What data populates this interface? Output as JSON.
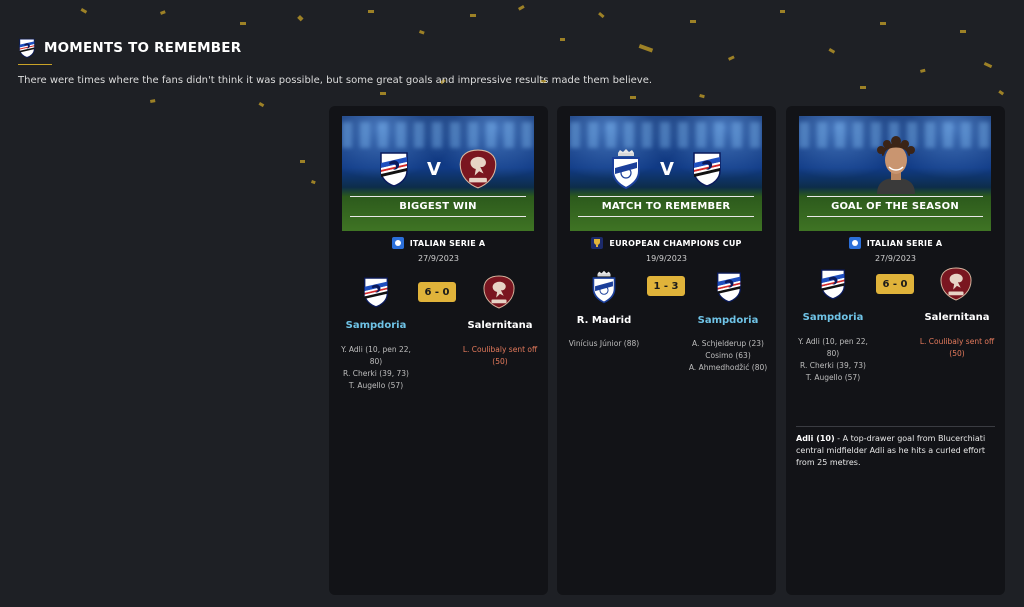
{
  "header": {
    "title": "MOMENTS TO REMEMBER",
    "subtitle": "There were times where the fans didn't think it was possible, but some great goals and impressive results made them believe.",
    "club_icon": "sampdoria-crest-icon"
  },
  "colors": {
    "accent_gold": "#e0b33a",
    "team_blue": "#6fc3e6",
    "red_card_text": "#e47a5c",
    "card_bg": "#121317"
  },
  "cards": [
    {
      "banner_label": "BIGGEST WIN",
      "banner_separator": "V",
      "banner_crests": [
        "sampdoria-crest-icon",
        "salernitana-crest-icon"
      ],
      "competition": "ITALIAN SERIE A",
      "competition_icon": "serie-a-icon",
      "date": "27/9/2023",
      "score": "6 - 0",
      "home_team": "Sampdoria",
      "away_team": "Salernitana",
      "home_events": [
        "Y. Adli (10, pen 22,",
        "80)",
        "R. Cherki (39, 73)",
        "T. Augello (57)"
      ],
      "away_events": [
        "L. Coulibaly sent off",
        "(50)"
      ]
    },
    {
      "banner_label": "MATCH TO REMEMBER",
      "banner_separator": "V",
      "banner_crests": [
        "real-madrid-crest-icon",
        "sampdoria-crest-icon"
      ],
      "competition": "EUROPEAN CHAMPIONS CUP",
      "competition_icon": "champions-cup-icon",
      "date": "19/9/2023",
      "score": "1 - 3",
      "home_team": "R. Madrid",
      "away_team": "Sampdoria",
      "home_events": [
        "Vinícius Júnior (88)"
      ],
      "away_events": [
        "A. Schjelderup (23)",
        "Cosimo (63)",
        "A. Ahmedhodžić (80)"
      ]
    },
    {
      "banner_label": "GOAL OF THE SEASON",
      "banner_player": "player-portrait-icon",
      "competition": "ITALIAN SERIE A",
      "competition_icon": "serie-a-icon",
      "date": "27/9/2023",
      "score": "6 - 0",
      "home_team": "Sampdoria",
      "away_team": "Salernitana",
      "home_events": [
        "Y. Adli (10, pen 22,",
        "80)",
        "R. Cherki (39, 73)",
        "T. Augello (57)"
      ],
      "away_events": [
        "L. Coulibaly sent off",
        "(50)"
      ],
      "goal_scorer": "Adli (10)",
      "goal_description": " - A top-drawer goal from Blucerchiati central midfielder Adli as he hits a curled effort from 25 metres."
    }
  ]
}
